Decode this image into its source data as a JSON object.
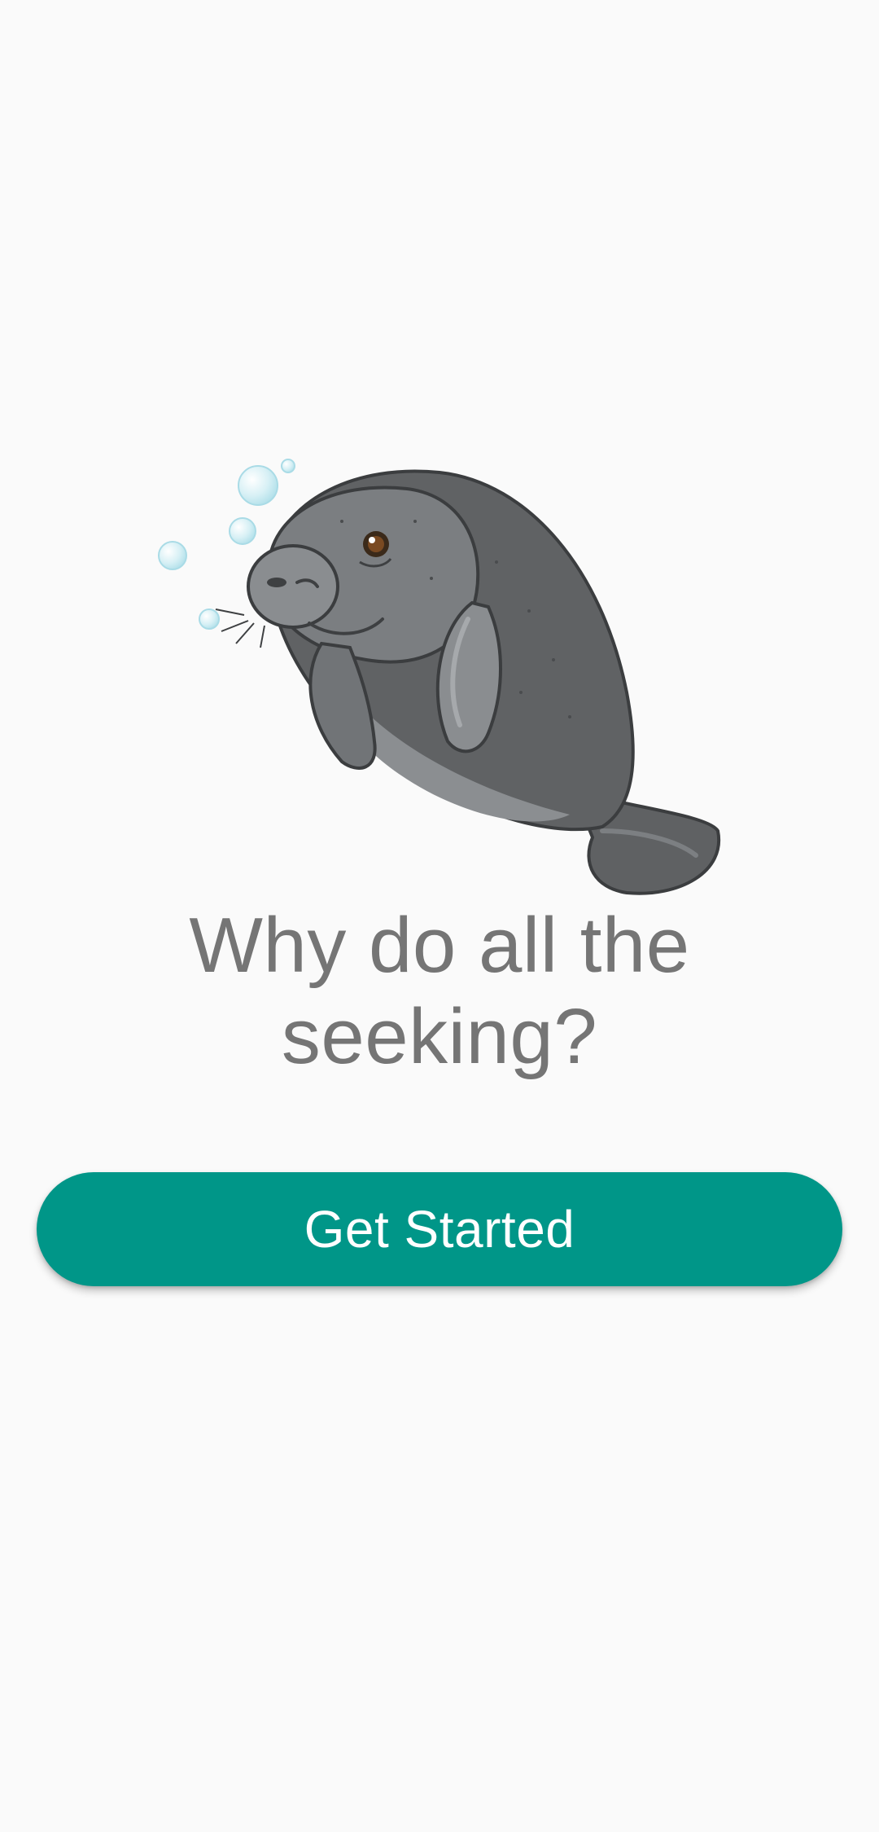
{
  "theme": {
    "background": "#fafafa",
    "accent": "#009688",
    "headline_color": "#757575"
  },
  "illustration": {
    "subject": "manatee",
    "icon": "manatee-illustration"
  },
  "onboarding": {
    "headline_line1": "Why do all the",
    "headline_line2": "seeking?",
    "cta_label": "Get Started"
  }
}
